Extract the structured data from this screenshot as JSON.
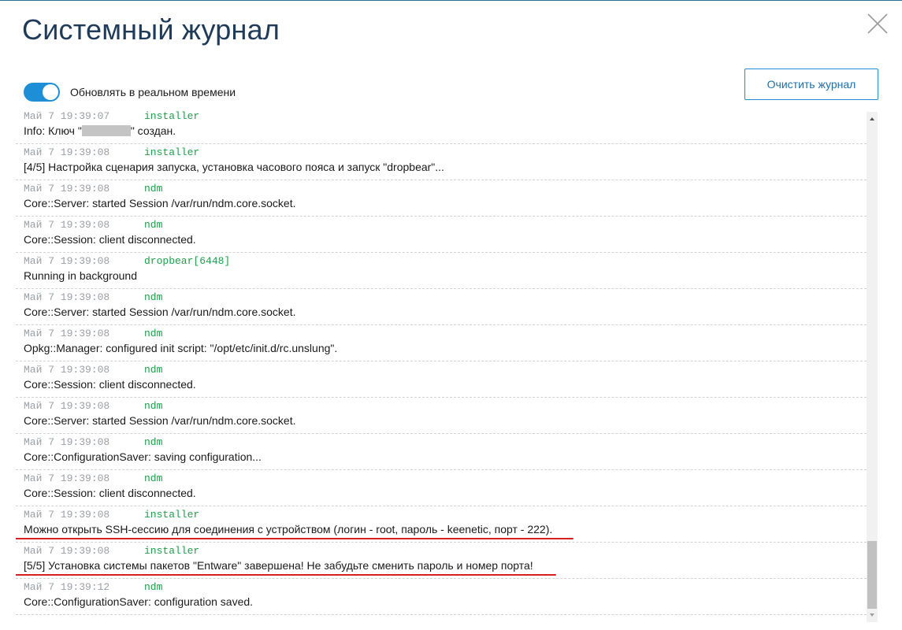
{
  "header": {
    "title": "Системный журнал"
  },
  "controls": {
    "realtime_label": "Обновлять в реальном времени",
    "realtime_enabled": true,
    "clear_button_label": "Очистить журнал"
  },
  "colors": {
    "accent": "#1e8fd6",
    "source_text": "#1e9e4a",
    "timestamp_text": "#9aa0a6",
    "annotation_underline": "#d62020"
  },
  "icons": {
    "close": "close-icon",
    "scroll_up": "scroll-up-arrow-icon",
    "scroll_down": "scroll-down-arrow-icon"
  },
  "log": [
    {
      "time": "Май 7 19:39:07",
      "source": "installer",
      "message_before": "Info: Ключ \"",
      "message_after": "\" создан.",
      "redacted": true
    },
    {
      "time": "Май 7 19:39:08",
      "source": "installer",
      "message": "[4/5] Настройка сценария запуска, установка часового пояса и запуск \"dropbear\"..."
    },
    {
      "time": "Май 7 19:39:08",
      "source": "ndm",
      "message": "Core::Server: started Session /var/run/ndm.core.socket."
    },
    {
      "time": "Май 7 19:39:08",
      "source": "ndm",
      "message": "Core::Session: client disconnected."
    },
    {
      "time": "Май 7 19:39:08",
      "source": "dropbear[6448]",
      "message": "Running in background"
    },
    {
      "time": "Май 7 19:39:08",
      "source": "ndm",
      "message": "Core::Server: started Session /var/run/ndm.core.socket."
    },
    {
      "time": "Май 7 19:39:08",
      "source": "ndm",
      "message": "Opkg::Manager: configured init script: \"/opt/etc/init.d/rc.unslung\"."
    },
    {
      "time": "Май 7 19:39:08",
      "source": "ndm",
      "message": "Core::Session: client disconnected."
    },
    {
      "time": "Май 7 19:39:08",
      "source": "ndm",
      "message": "Core::Server: started Session /var/run/ndm.core.socket."
    },
    {
      "time": "Май 7 19:39:08",
      "source": "ndm",
      "message": "Core::ConfigurationSaver: saving configuration..."
    },
    {
      "time": "Май 7 19:39:08",
      "source": "ndm",
      "message": "Core::Session: client disconnected."
    },
    {
      "time": "Май 7 19:39:08",
      "source": "installer",
      "message": "Можно открыть SSH-сессию для соединения с устройством (логин - root, пароль - keenetic, порт - 222).",
      "underlined": true
    },
    {
      "time": "Май 7 19:39:08",
      "source": "installer",
      "message": "[5/5] Установка системы пакетов \"Entware\" завершена! Не забудьте сменить пароль и номер порта!",
      "underlined": true
    },
    {
      "time": "Май 7 19:39:12",
      "source": "ndm",
      "message": "Core::ConfigurationSaver: configuration saved."
    }
  ]
}
